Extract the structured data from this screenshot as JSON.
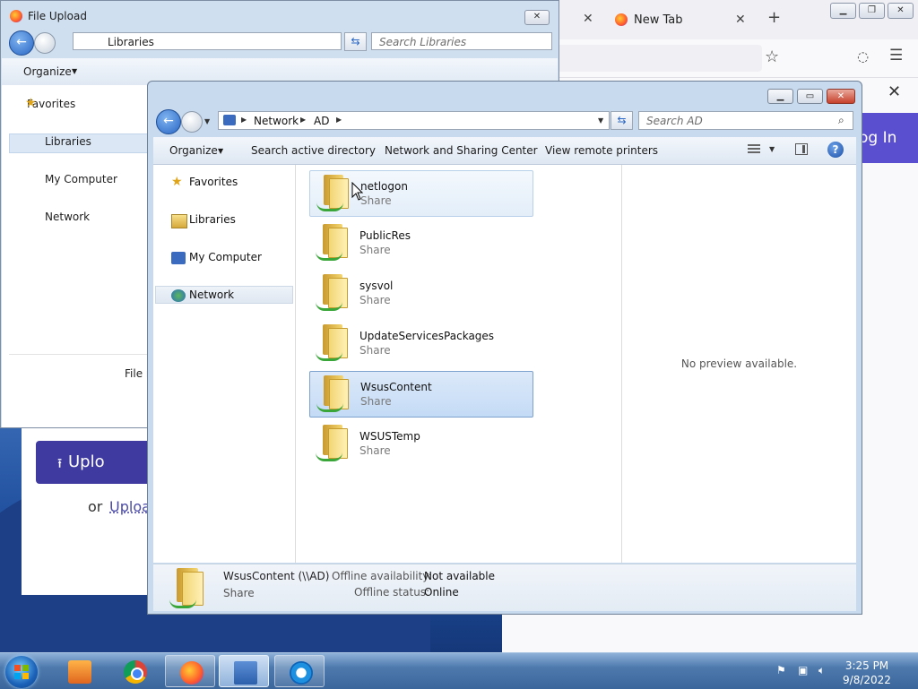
{
  "browser": {
    "tab_title": "New Tab",
    "close_glyph": "✕",
    "new_tab_glyph": "+",
    "menu_glyph": "☰",
    "star_glyph": "☆",
    "pocket_glyph": "◌",
    "page_close_glyph": "✕",
    "login_label": "og In"
  },
  "file_upload": {
    "title": "File Upload",
    "address": "Libraries",
    "search_placeholder": "Search Libraries",
    "organize": "Organize",
    "nav": [
      "Favorites",
      "Libraries",
      "My Computer",
      "Network"
    ],
    "file_label": "File n",
    "upload_button": "Uplo",
    "or_text": "or",
    "upload_link": "Uploa"
  },
  "explorer": {
    "breadcrumb": [
      "Network",
      "AD"
    ],
    "search_placeholder": "Search AD",
    "toolbar": {
      "organize": "Organize",
      "search_ad": "Search active directory",
      "network_sharing": "Network and Sharing Center",
      "remote_printers": "View remote printers"
    },
    "nav": [
      "Favorites",
      "Libraries",
      "My Computer",
      "Network"
    ],
    "items": [
      {
        "name": "netlogon",
        "type": "Share"
      },
      {
        "name": "PublicRes",
        "type": "Share"
      },
      {
        "name": "sysvol",
        "type": "Share"
      },
      {
        "name": "UpdateServicesPackages",
        "type": "Share"
      },
      {
        "name": "WsusContent",
        "type": "Share"
      },
      {
        "name": "WSUSTemp",
        "type": "Share"
      }
    ],
    "preview_text": "No preview available.",
    "details": {
      "name": "WsusContent (\\\\AD)",
      "type": "Share",
      "offline_availability_label": "Offline availability:",
      "offline_availability_value": "Not available",
      "offline_status_label": "Offline status:",
      "offline_status_value": "Online"
    }
  },
  "taskbar": {
    "time": "3:25 PM",
    "date": "9/8/2022"
  },
  "colors": {
    "selection": "#c4dbf6",
    "accent": "#3f3aa0"
  }
}
